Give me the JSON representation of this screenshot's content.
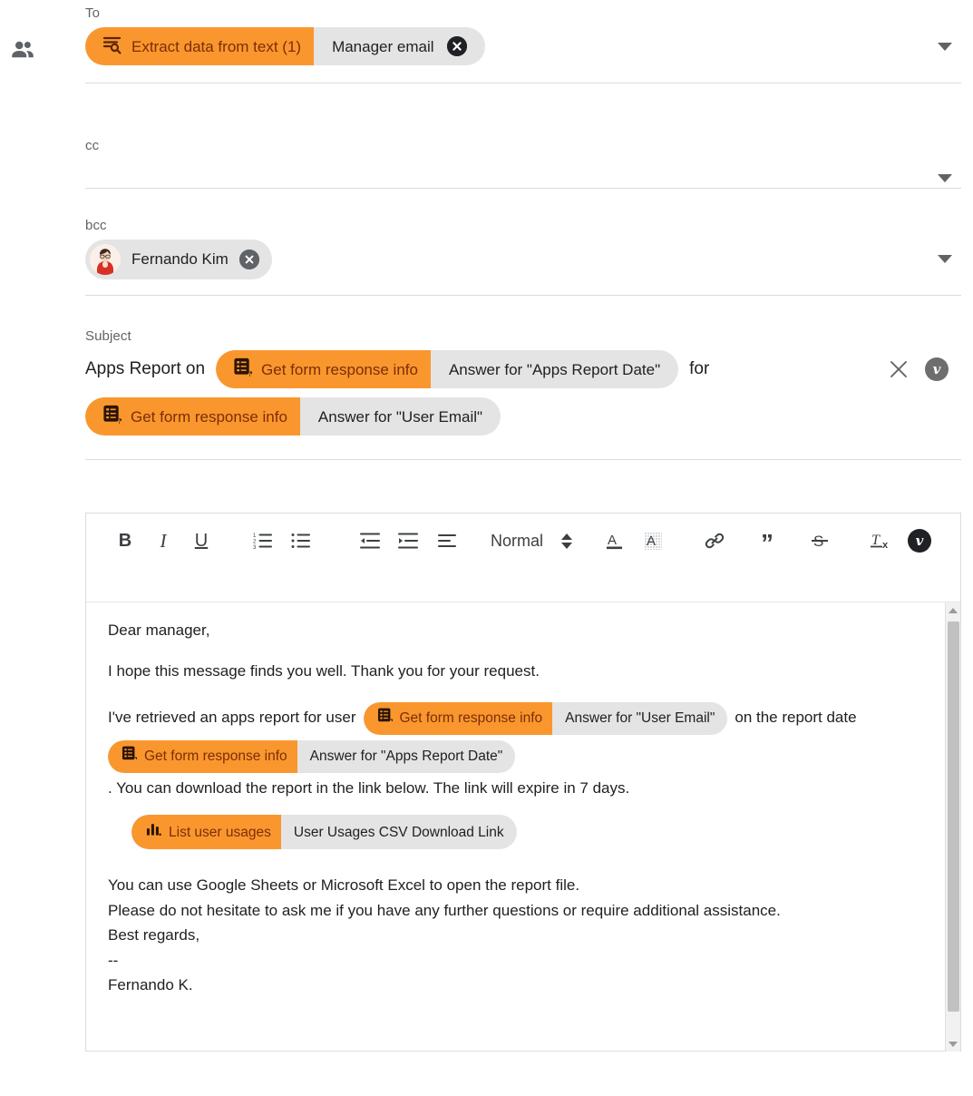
{
  "gutter": {
    "icon": "people-icon"
  },
  "colors": {
    "chip_source_bg": "#f9972e",
    "chip_source_text": "#7d2d08",
    "chip_value_bg": "#e4e4e4",
    "border": "#dadce0"
  },
  "fields": {
    "to": {
      "label": "To",
      "chip": {
        "icon": "extract-data-icon",
        "source": "Extract data from text (1)",
        "value": "Manager email"
      },
      "remove": "remove-icon",
      "caret": "chevron-down-icon"
    },
    "cc": {
      "label": "cc",
      "caret": "chevron-down-icon"
    },
    "bcc": {
      "label": "bcc",
      "recipient": {
        "name": "Fernando Kim",
        "avatar": "person-avatar"
      },
      "remove": "remove-icon",
      "caret": "chevron-down-icon"
    },
    "subject": {
      "label": "Subject",
      "parts": [
        {
          "kind": "text",
          "text": "Apps Report on"
        },
        {
          "kind": "chip",
          "icon": "form-response-icon",
          "source": "Get form response info",
          "value": "Answer for \"Apps Report Date\""
        },
        {
          "kind": "text",
          "text": "for"
        },
        {
          "kind": "chip",
          "icon": "form-response-icon",
          "source": "Get form response info",
          "value": "Answer for \"User Email\""
        }
      ],
      "clear_label": "close-icon",
      "badge_label": "v"
    }
  },
  "editor": {
    "toolbar": {
      "bold": "B",
      "italic": "I",
      "underline": "U",
      "ordered_list": "ordered-list-icon",
      "bullet_list": "bullet-list-icon",
      "outdent": "outdent-icon",
      "indent": "indent-icon",
      "align": "align-icon",
      "style_name": "Normal",
      "stepper": "stepper-icon",
      "text_color": "A",
      "highlight_color": "A",
      "link": "link-icon",
      "blockquote": "”",
      "strikethrough": "S",
      "clear_format": "T",
      "variable_badge": "v"
    },
    "body": {
      "greeting": "Dear manager,",
      "intro": "I hope this message finds you well. Thank you for your request.",
      "main_part1": "I've retrieved an apps report for user",
      "main_chip1": {
        "icon": "form-response-icon",
        "source": "Get form response info",
        "value": "Answer for \"User Email\""
      },
      "main_part2": "on the report date",
      "main_chip2": {
        "icon": "form-response-icon",
        "source": "Get form response info",
        "value": "Answer for \"Apps Report Date\""
      },
      "main_part3": ". You can download the report in the link below. The link will expire in 7 days.",
      "link_chip": {
        "icon": "bar-chart-icon",
        "source": "List user usages",
        "value": "User Usages CSV Download Link"
      },
      "closing_line1": "You can use Google Sheets or Microsoft Excel to open the report file.",
      "closing_line2": "Please do not hesitate to ask me if you have any further questions or require additional assistance.",
      "closing_line3": "Best regards,",
      "closing_line4": "--",
      "closing_line5": "Fernando K."
    },
    "scrollbar": {
      "up": "scroll-up-icon",
      "down": "scroll-down-icon",
      "thumb": "scroll-thumb"
    }
  }
}
